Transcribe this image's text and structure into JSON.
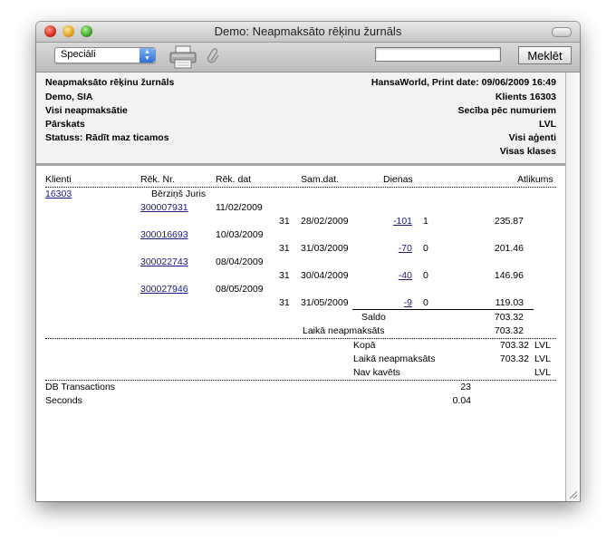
{
  "window": {
    "title": "Demo: Neapmaksāto rēķinu žurnāls"
  },
  "toolbar": {
    "select_value": "Speciāli",
    "search_placeholder": "",
    "search_button": "Meklēt",
    "printer_icon": "printer-icon",
    "attach_icon": "paperclip-icon"
  },
  "header": {
    "left": [
      "Neapmaksāto rēķinu žurnāls",
      "Demo, SIA",
      "Visi neapmaksātie",
      "Pārskats",
      "Statuss: Rādīt maz ticamos"
    ],
    "right": [
      "HansaWorld, Print date: 09/06/2009 16:49",
      "Klients 16303",
      "Secība pēc numuriem",
      "LVL",
      "Visi aģenti",
      "Visas klases"
    ]
  },
  "columns": {
    "klients": "Klienti",
    "rek_nr": "Rēk. Nr.",
    "rek_dat": "Rēk. dat",
    "sam_dat": "Sam.dat.",
    "dienas": "Dienas",
    "atlikums": "Atlikums"
  },
  "customer": {
    "code": "16303",
    "name": "Bērziņš Juris"
  },
  "invoices": [
    {
      "nr": "300007931",
      "date": "11/02/2009",
      "term": "31",
      "due": "28/02/2009",
      "days": "-101",
      "count": "1",
      "amount": "235.87"
    },
    {
      "nr": "300016693",
      "date": "10/03/2009",
      "term": "31",
      "due": "31/03/2009",
      "days": "-70",
      "count": "0",
      "amount": "201.46"
    },
    {
      "nr": "300022743",
      "date": "08/04/2009",
      "term": "31",
      "due": "30/04/2009",
      "days": "-40",
      "count": "0",
      "amount": "146.96"
    },
    {
      "nr": "300027946",
      "date": "08/05/2009",
      "term": "31",
      "due": "31/05/2009",
      "days": "-9",
      "count": "0",
      "amount": "119.03"
    }
  ],
  "subtotal": {
    "saldo_label": "Saldo",
    "saldo": "703.32",
    "late_label": "Laikā neapmaksāts",
    "late": "703.32"
  },
  "totals": {
    "kopa_label": "Kopā",
    "kopa": "703.32",
    "kopa_cur": "LVL",
    "late_label": "Laikā neapmaksāts",
    "late": "703.32",
    "late_cur": "LVL",
    "nav_label": "Nav kavēts",
    "nav_cur": "LVL"
  },
  "stats": {
    "db_label": "DB Transactions",
    "db": "23",
    "sec_label": "Seconds",
    "sec": "0.04"
  }
}
